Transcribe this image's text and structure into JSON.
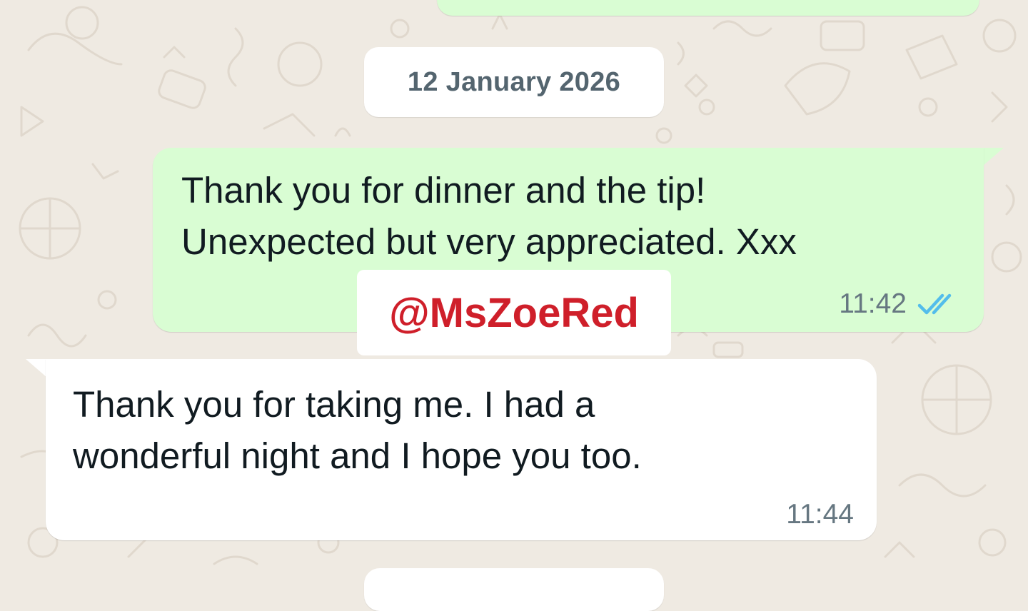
{
  "chat": {
    "date_separator": "12 January 2026",
    "messages": [
      {
        "direction": "outgoing",
        "text": "Thank you for dinner and the tip!\nUnexpected but very appreciated. Xxx",
        "time": "11:42",
        "status_icon": "double-check-read-icon"
      },
      {
        "direction": "incoming",
        "text": "Thank you for taking me. I had a\nwonderful night and I hope you too.",
        "time": "11:44"
      }
    ]
  },
  "watermark": {
    "text": "@MsZoeRed",
    "color": "#cf1f2a"
  },
  "colors": {
    "background": "#efeae2",
    "outgoing_bubble": "#d9fdd3",
    "incoming_bubble": "#ffffff",
    "read_ticks": "#53bdeb",
    "meta_text": "#667781"
  }
}
